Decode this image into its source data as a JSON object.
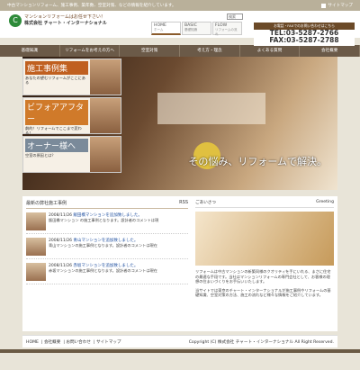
{
  "topbar": {
    "text": "中古マンションリフォーム、施工事例、築年数、空室対策、などの情報を紹介しています。",
    "sitemap": "サイトマップ"
  },
  "header": {
    "catch": "マンションリフォームはお任せ下さい！",
    "company": "株式会社 チャート・インターナショナル",
    "search_label": "検索"
  },
  "gnav": [
    {
      "label": "HOME",
      "sub": "ホーム"
    },
    {
      "label": "BASIC",
      "sub": "基礎知識"
    },
    {
      "label": "FLOW",
      "sub": "リフォームの流れ"
    }
  ],
  "tel": {
    "note": "お電話・FAXでのお問い合わせはこちら",
    "tel": "TEL:03-5287-2766",
    "fax": "FAX:03-5287-2788"
  },
  "menu": [
    "基礎知識",
    "リフォームをお考えの方へ",
    "空室対策",
    "考え方・理念",
    "よくある質問",
    "会社概要"
  ],
  "features": [
    {
      "title": "施工事例集",
      "desc": "あなたの望むリフォームがここにある"
    },
    {
      "title": "ビフォアアフター",
      "desc": "劇的！リフォームでここまで変わる！"
    },
    {
      "title": "オーナー様へ",
      "desc": "空室の原因とは？"
    }
  ],
  "hero": {
    "catch": "その悩み、リフォームで解決。"
  },
  "news": {
    "title": "最新の弊社施工事例",
    "rss": "RSS",
    "items": [
      {
        "date": "2008/11/26",
        "link": "飯田橋マンションを追加致しました。",
        "msg": "飯田橋マンション の施工事例となります。設計者のコメントは現"
      },
      {
        "date": "2008/11/26",
        "link": "青山マンションを追加致しました。",
        "msg": "青山マンションの施工事例となります。設計者のコメントは現在"
      },
      {
        "date": "2008/11/26",
        "link": "赤坂マンションを追加致しました。",
        "msg": "赤坂マンションの施工事例となります。設計者のコメントは現在"
      }
    ]
  },
  "greeting": {
    "title": "ごあいさつ",
    "en": "Greeting",
    "text": "リフォームは中古マンションの新築同様のクオリティを手にいれる、まさに住宅の最適な手段です。当社はマンションリフォームの専門会社として、お客様の理想の住まいづくりをお手伝いいたします。",
    "text2": "当サイトでは東京のチャート・インターナショナルが施工事例やリフォームの基礎知識、空室対策の方法、施工の流れなど様々な情報をご紹介しています。"
  },
  "footer": {
    "links": [
      "HOME",
      "会社概要",
      "お問い合わせ",
      "サイトマップ"
    ],
    "copyright": "Copyright (C) 株式会社 チャート・インターナショナル All Right Reserved."
  }
}
